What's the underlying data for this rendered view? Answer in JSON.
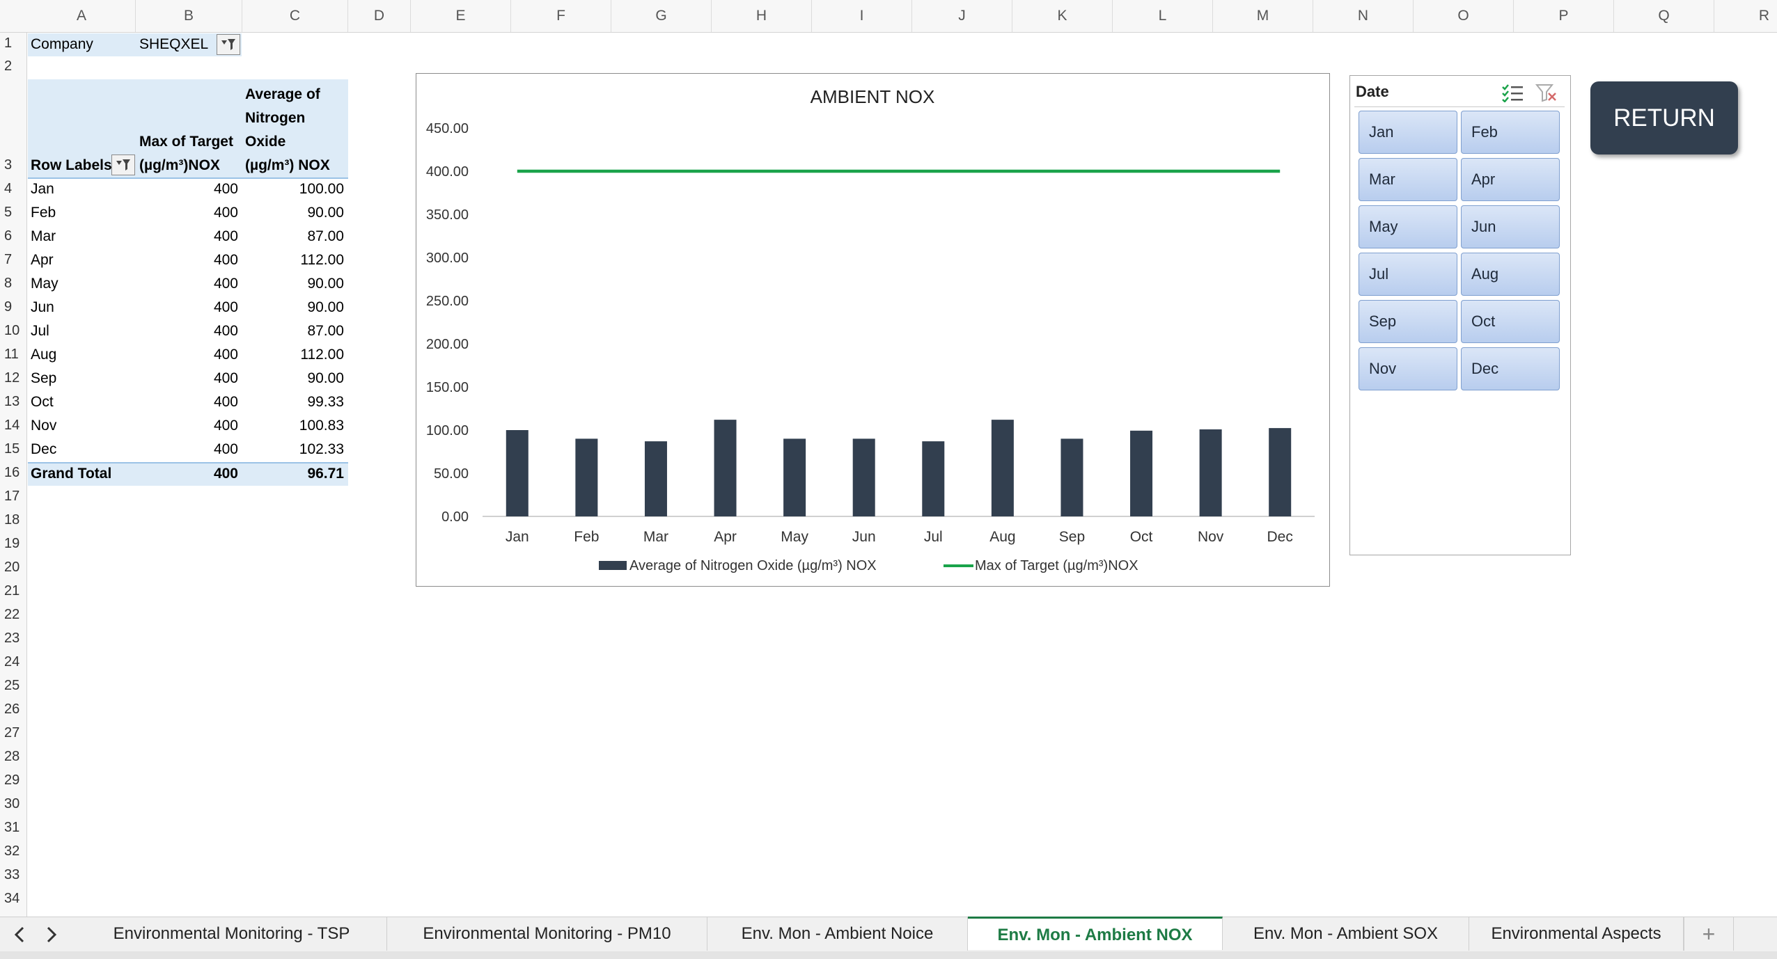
{
  "columns": [
    "A",
    "B",
    "C",
    "D",
    "E",
    "F",
    "G",
    "H",
    "I",
    "J",
    "K",
    "L",
    "M",
    "N",
    "O",
    "P",
    "Q",
    "R"
  ],
  "rows": [
    "1",
    "2",
    "3",
    "4",
    "5",
    "6",
    "7",
    "8",
    "9",
    "10",
    "11",
    "12",
    "13",
    "14",
    "15",
    "16",
    "17",
    "18",
    "19",
    "20",
    "21",
    "22",
    "23",
    "24",
    "25",
    "26",
    "27",
    "28",
    "29",
    "30",
    "31",
    "32",
    "33",
    "34"
  ],
  "filter": {
    "label": "Company",
    "value": "SHEQXEL"
  },
  "pivot": {
    "header_row_labels": "Row Labels",
    "header_target": [
      "Max of Target",
      "(µg/m³)NOX"
    ],
    "header_avg": [
      "Average of",
      "Nitrogen",
      "Oxide",
      "(µg/m³) NOX"
    ],
    "rows": [
      {
        "label": "Jan",
        "target": "400",
        "avg": "100.00"
      },
      {
        "label": "Feb",
        "target": "400",
        "avg": "90.00"
      },
      {
        "label": "Mar",
        "target": "400",
        "avg": "87.00"
      },
      {
        "label": "Apr",
        "target": "400",
        "avg": "112.00"
      },
      {
        "label": "May",
        "target": "400",
        "avg": "90.00"
      },
      {
        "label": "Jun",
        "target": "400",
        "avg": "90.00"
      },
      {
        "label": "Jul",
        "target": "400",
        "avg": "87.00"
      },
      {
        "label": "Aug",
        "target": "400",
        "avg": "112.00"
      },
      {
        "label": "Sep",
        "target": "400",
        "avg": "90.00"
      },
      {
        "label": "Oct",
        "target": "400",
        "avg": "99.33"
      },
      {
        "label": "Nov",
        "target": "400",
        "avg": "100.83"
      },
      {
        "label": "Dec",
        "target": "400",
        "avg": "102.33"
      }
    ],
    "grand_total": {
      "label": "Grand Total",
      "target": "400",
      "avg": "96.71"
    }
  },
  "chart_data": {
    "type": "bar",
    "title": "AMBIENT NOX",
    "categories": [
      "Jan",
      "Feb",
      "Mar",
      "Apr",
      "May",
      "Jun",
      "Jul",
      "Aug",
      "Sep",
      "Oct",
      "Nov",
      "Dec"
    ],
    "series": [
      {
        "name": "Average of Nitrogen Oxide  (µg/m³) NOX",
        "type": "bar",
        "color": "#323f4f",
        "values": [
          100,
          90,
          87,
          112,
          90,
          90,
          87,
          112,
          90,
          99.33,
          100.83,
          102.33
        ]
      },
      {
        "name": "Max of Target (µg/m³)NOX",
        "type": "line",
        "color": "#1aa34a",
        "values": [
          400,
          400,
          400,
          400,
          400,
          400,
          400,
          400,
          400,
          400,
          400,
          400
        ]
      }
    ],
    "ylim": [
      0,
      450
    ],
    "yticks": [
      "0.00",
      "50.00",
      "100.00",
      "150.00",
      "200.00",
      "250.00",
      "300.00",
      "350.00",
      "400.00",
      "450.00"
    ],
    "legend_position": "bottom",
    "grid": false
  },
  "slicer": {
    "title": "Date",
    "items": [
      "Jan",
      "Feb",
      "Mar",
      "Apr",
      "May",
      "Jun",
      "Jul",
      "Aug",
      "Sep",
      "Oct",
      "Nov",
      "Dec"
    ]
  },
  "return_button": "RETURN",
  "sheet_tabs": [
    {
      "label": "Environmental Monitoring - TSP",
      "active": false
    },
    {
      "label": "Environmental Monitoring - PM10",
      "active": false
    },
    {
      "label": "Env. Mon - Ambient Noice",
      "active": false
    },
    {
      "label": "Env. Mon - Ambient NOX",
      "active": true
    },
    {
      "label": "Env. Mon - Ambient SOX",
      "active": false
    },
    {
      "label": "Environmental Aspects",
      "active": false
    }
  ],
  "add_sheet_label": "+"
}
